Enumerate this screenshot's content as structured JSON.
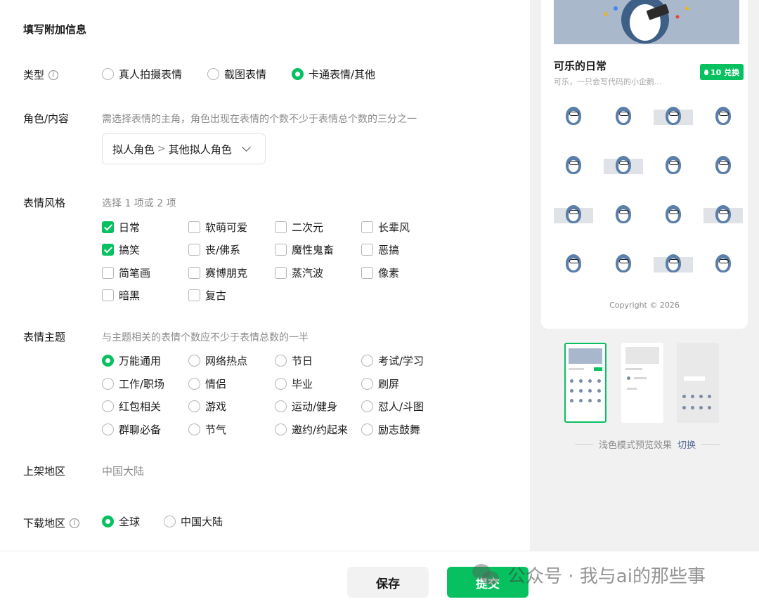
{
  "section_title": "填写附加信息",
  "type": {
    "label": "类型",
    "options": [
      {
        "label": "真人拍摄表情",
        "selected": false
      },
      {
        "label": "截图表情",
        "selected": false
      },
      {
        "label": "卡通表情/其他",
        "selected": true
      }
    ]
  },
  "role": {
    "label": "角色/内容",
    "hint": "需选择表情的主角，角色出现在表情的个数不少于表情总个数的三分之一",
    "select_primary": "拟人角色",
    "select_separator": ">",
    "select_secondary": "其他拟人角色"
  },
  "style": {
    "label": "表情风格",
    "hint": "选择 1 项或 2 项",
    "options": [
      {
        "label": "日常",
        "checked": true
      },
      {
        "label": "软萌可爱",
        "checked": false
      },
      {
        "label": "二次元",
        "checked": false
      },
      {
        "label": "长辈风",
        "checked": false
      },
      {
        "label": "搞笑",
        "checked": true
      },
      {
        "label": "丧/佛系",
        "checked": false
      },
      {
        "label": "魔性鬼畜",
        "checked": false
      },
      {
        "label": "恶搞",
        "checked": false
      },
      {
        "label": "简笔画",
        "checked": false
      },
      {
        "label": "赛博朋克",
        "checked": false
      },
      {
        "label": "蒸汽波",
        "checked": false
      },
      {
        "label": "像素",
        "checked": false
      },
      {
        "label": "暗黑",
        "checked": false
      },
      {
        "label": "复古",
        "checked": false
      }
    ]
  },
  "theme": {
    "label": "表情主题",
    "hint": "与主题相关的表情个数应不少于表情总数的一半",
    "options": [
      {
        "label": "万能通用",
        "selected": true
      },
      {
        "label": "网络热点",
        "selected": false
      },
      {
        "label": "节日",
        "selected": false
      },
      {
        "label": "考试/学习",
        "selected": false
      },
      {
        "label": "工作/职场",
        "selected": false
      },
      {
        "label": "情侣",
        "selected": false
      },
      {
        "label": "毕业",
        "selected": false
      },
      {
        "label": "刷屏",
        "selected": false
      },
      {
        "label": "红包相关",
        "selected": false
      },
      {
        "label": "游戏",
        "selected": false
      },
      {
        "label": "运动/健身",
        "selected": false
      },
      {
        "label": "怼人/斗图",
        "selected": false
      },
      {
        "label": "群聊必备",
        "selected": false
      },
      {
        "label": "节气",
        "selected": false
      },
      {
        "label": "邀约/约起来",
        "selected": false
      },
      {
        "label": "励志鼓舞",
        "selected": false
      }
    ]
  },
  "listing_region": {
    "label": "上架地区",
    "value": "中国大陆"
  },
  "download_region": {
    "label": "下载地区",
    "options": [
      {
        "label": "全球",
        "selected": true
      },
      {
        "label": "中国大陆",
        "selected": false
      }
    ]
  },
  "buttons": {
    "save": "保存",
    "submit": "提交"
  },
  "watermark": "公众号 · 我与ai的那些事",
  "preview": {
    "pack_title": "可乐的日常",
    "pack_subtitle": "可乐，一只会写代码的小企鹅...",
    "redeem_label": "10 兑换",
    "copyright": "Copyright © 2026",
    "mode_text": "浅色模式预览效果",
    "switch_label": "切换",
    "sticker_count": 16
  },
  "colors": {
    "accent": "#07c160",
    "link": "#576b95",
    "muted": "#8a8a8a"
  }
}
